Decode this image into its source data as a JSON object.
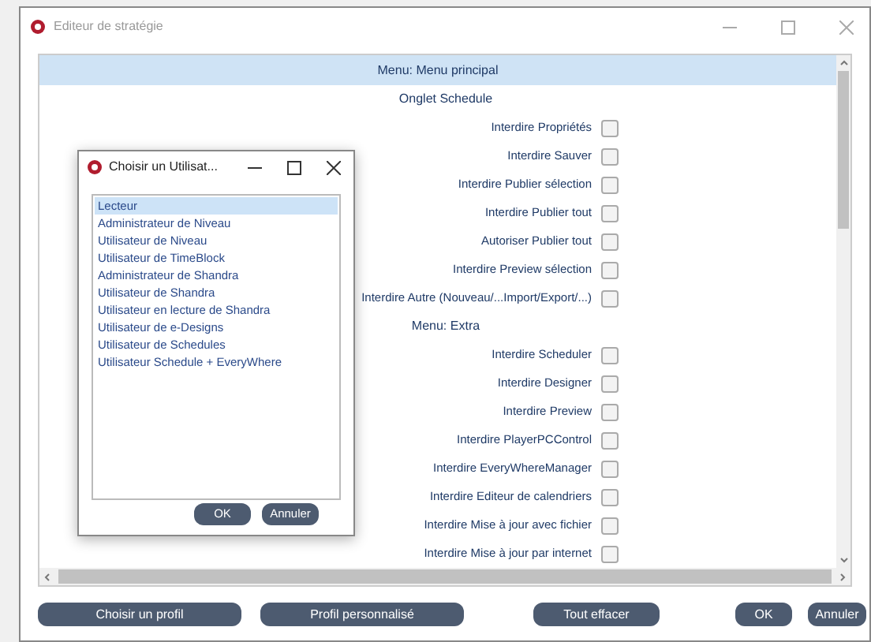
{
  "window": {
    "title": "Editeur de stratégie"
  },
  "panel": {
    "header": "Menu: Menu principal",
    "rows": [
      {
        "kind": "heading",
        "label": "Onglet Schedule"
      },
      {
        "kind": "option",
        "label": "Interdire Propriétés",
        "checked": false
      },
      {
        "kind": "option",
        "label": "Interdire Sauver",
        "checked": false
      },
      {
        "kind": "option",
        "label": "Interdire Publier sélection",
        "checked": false
      },
      {
        "kind": "option",
        "label": "Interdire Publier tout",
        "checked": false
      },
      {
        "kind": "option",
        "label": "Autoriser Publier tout",
        "checked": false
      },
      {
        "kind": "option",
        "label": "Interdire Preview sélection",
        "checked": false
      },
      {
        "kind": "option",
        "label": "Interdire Autre (Nouveau/...Import/Export/...)",
        "checked": false
      },
      {
        "kind": "heading",
        "label": "Menu: Extra"
      },
      {
        "kind": "option",
        "label": "Interdire Scheduler",
        "checked": false
      },
      {
        "kind": "option",
        "label": "Interdire Designer",
        "checked": false
      },
      {
        "kind": "option",
        "label": "Interdire Preview",
        "checked": false
      },
      {
        "kind": "option",
        "label": "Interdire PlayerPCControl",
        "checked": false
      },
      {
        "kind": "option",
        "label": "Interdire EveryWhereManager",
        "checked": false
      },
      {
        "kind": "option",
        "label": "Interdire Editeur de calendriers",
        "checked": false
      },
      {
        "kind": "option",
        "label": "Interdire Mise à jour avec fichier",
        "checked": false
      },
      {
        "kind": "option",
        "label": "Interdire Mise à jour par internet",
        "checked": false
      }
    ]
  },
  "dialog": {
    "title": "Choisir un Utilisat...",
    "items": [
      {
        "label": "Lecteur",
        "selected": true
      },
      {
        "label": "Administrateur de Niveau",
        "selected": false
      },
      {
        "label": "Utilisateur de Niveau",
        "selected": false
      },
      {
        "label": "Utilisateur de TimeBlock",
        "selected": false
      },
      {
        "label": "Administrateur de Shandra",
        "selected": false
      },
      {
        "label": "Utilisateur de Shandra",
        "selected": false
      },
      {
        "label": "Utilisateur en lecture de Shandra",
        "selected": false
      },
      {
        "label": "Utilisateur de e-Designs",
        "selected": false
      },
      {
        "label": "Utilisateur de Schedules",
        "selected": false
      },
      {
        "label": "Utilisateur Schedule + EveryWhere",
        "selected": false
      }
    ],
    "buttons": [
      "OK",
      "Annuler"
    ]
  },
  "buttons": [
    "Choisir un profil",
    "Profil personnalisé",
    "Tout effacer",
    "OK",
    "Annuler"
  ]
}
